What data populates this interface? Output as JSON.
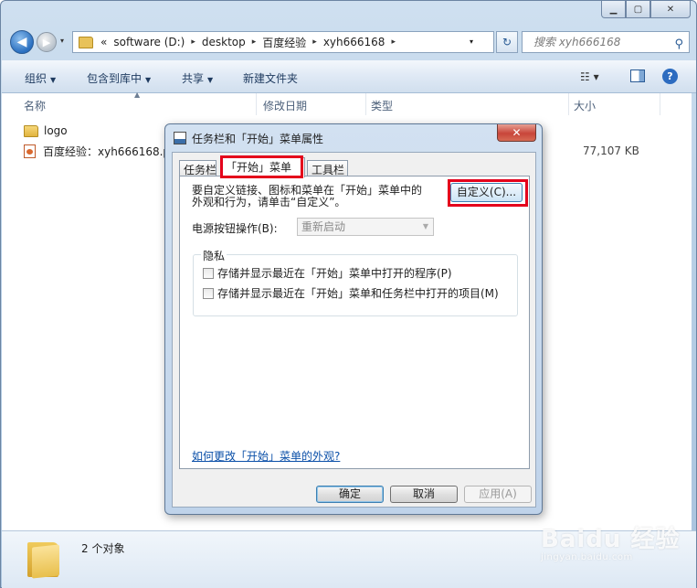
{
  "window": {
    "caption_buttons": {
      "minimize": "▁",
      "maximize": "▢",
      "close": "✕"
    }
  },
  "nav": {
    "breadcrumb_prefix": "«",
    "breadcrumbs": [
      "software (D:)",
      "desktop",
      "百度经验",
      "xyh666168"
    ],
    "crumb_sep": "▸",
    "dropdown_arrow": "▾",
    "search_placeholder": "搜索 xyh666168"
  },
  "toolbar": {
    "organize": "组织",
    "include_in_library": "包含到库中",
    "share": "共享",
    "new_folder": "新建文件夹",
    "dropdown_arrow": "▼",
    "view_glyph": "☷ ▾",
    "help_glyph": "?"
  },
  "columns": {
    "name": "名称",
    "modified": "修改日期",
    "type": "类型",
    "size": "大小"
  },
  "files": [
    {
      "name": "logo",
      "kind": "folder"
    },
    {
      "name": "百度经验：xyh666168.pr",
      "kind": "document",
      "size": "77,107 KB"
    }
  ],
  "details": {
    "count": "2 个对象"
  },
  "watermark": {
    "main": "Baidu 经验",
    "sub": "jingyan.baidu.com"
  },
  "dialog": {
    "title": "任务栏和「开始」菜单属性",
    "close_glyph": "✕",
    "tabs": [
      "任务栏",
      "「开始」菜单",
      "工具栏"
    ],
    "active_tab": 1,
    "description": "要自定义链接、图标和菜单在「开始」菜单中的外观和行为，请单击“自定义”。",
    "customize_button": "自定义(C)...",
    "power_label": "电源按钮操作(B):",
    "power_value": "重新启动",
    "privacy_group": "隐私",
    "privacy_option1": "存储并显示最近在「开始」菜单中打开的程序(P)",
    "privacy_option2": "存储并显示最近在「开始」菜单和任务栏中打开的项目(M)",
    "help_link": "如何更改「开始」菜单的外观?",
    "ok": "确定",
    "cancel": "取消",
    "apply": "应用(A)"
  },
  "colors": {
    "highlight": "#e4001b",
    "link": "#0a4fa8"
  }
}
